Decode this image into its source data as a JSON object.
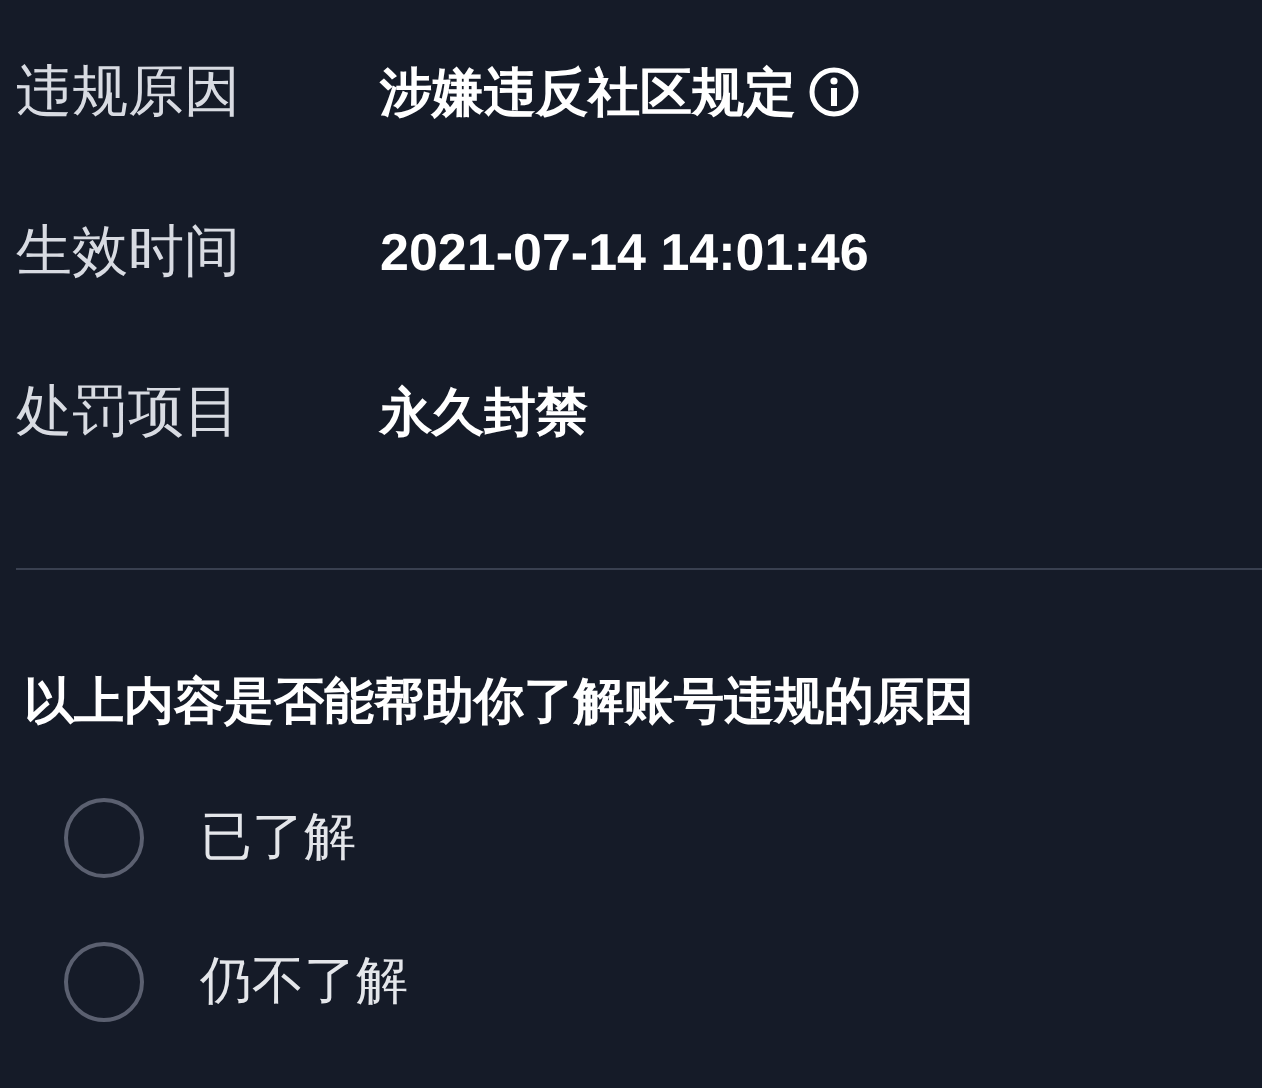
{
  "details": [
    {
      "label": "违规原因",
      "value": "涉嫌违反社区规定",
      "info": true
    },
    {
      "label": "生效时间",
      "value": "2021-07-14 14:01:46",
      "info": false
    },
    {
      "label": "处罚项目",
      "value": "永久封禁",
      "info": false
    }
  ],
  "question": "以上内容是否能帮助你了解账号违规的原因",
  "options": [
    {
      "label": "已了解",
      "selected": false
    },
    {
      "label": "仍不了解",
      "selected": false
    }
  ]
}
